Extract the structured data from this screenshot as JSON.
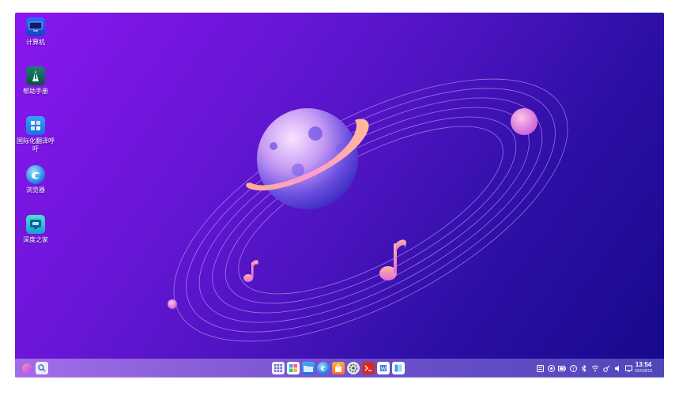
{
  "desktop": {
    "icons": [
      {
        "label": "计算机",
        "icon": "computer-icon"
      },
      {
        "label": "帮助手册",
        "icon": "help-manual-icon"
      },
      {
        "label": "国际化翻译呼吁",
        "icon": "translation-icon"
      },
      {
        "label": "浏览器",
        "icon": "browser-icon"
      },
      {
        "label": "深度之家",
        "icon": "deepin-home-icon"
      }
    ]
  },
  "taskbar": {
    "left": [
      "launcher-icon",
      "search-icon"
    ],
    "apps": [
      "multitask-view-icon",
      "app-store-icon",
      "file-manager-icon",
      "browser-icon",
      "app-store-bag-icon",
      "settings-icon",
      "terminal-icon",
      "text-editor-icon",
      "split-window-icon"
    ],
    "tray": [
      "notification-icon",
      "keyboard-icon",
      "battery-icon",
      "help-icon",
      "bluetooth-icon",
      "wifi-icon",
      "vpn-icon",
      "volume-icon",
      "screen-icon"
    ],
    "clock": {
      "time": "13:54",
      "date": "2025/8/19"
    }
  },
  "colors": {
    "wallpaper_start": "#8a17f0",
    "wallpaper_end": "#16098a",
    "accent": "#ff9a6b"
  }
}
